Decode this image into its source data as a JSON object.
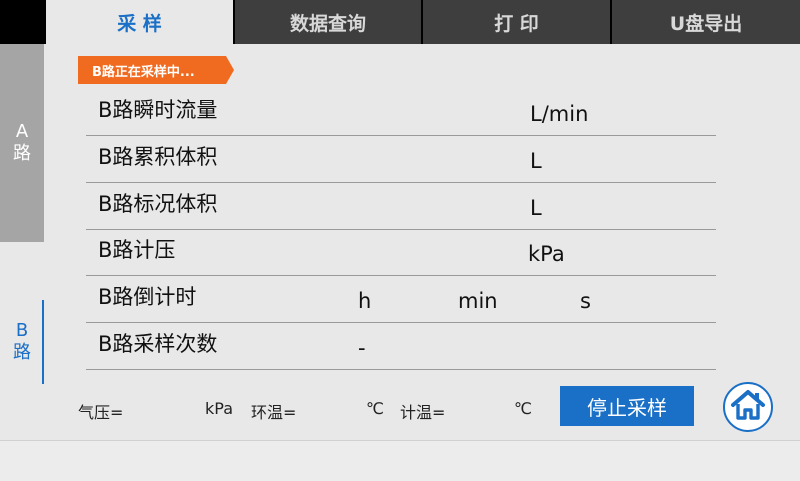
{
  "tabs": [
    {
      "label": "采 样"
    },
    {
      "label": "数据查询"
    },
    {
      "label": "打 印"
    },
    {
      "label": "U盘导出"
    }
  ],
  "side": {
    "a_letter": "A",
    "a_char": "路",
    "b_letter": "B",
    "b_char": "路"
  },
  "status": "B路正在采样中...",
  "rows": [
    {
      "label": "B路瞬时流量",
      "unit": "L/min"
    },
    {
      "label": "B路累积体积",
      "unit": "L"
    },
    {
      "label": "B路标况体积",
      "unit": "L"
    },
    {
      "label": "B路计压",
      "unit": "kPa"
    },
    {
      "label": "B路倒计时",
      "h": "h",
      "min": "min",
      "s": "s"
    },
    {
      "label": "B路采样次数",
      "value": "-"
    }
  ],
  "footer": {
    "pressure_label": "气压=",
    "pressure_unit": "kPa",
    "ambient_label": "环温=",
    "ambient_unit": "℃",
    "meter_label": "计温=",
    "meter_unit": "℃",
    "stop_button": "停止采样"
  },
  "colors": {
    "accent": "#1a6fc6",
    "status": "#f06a1f"
  },
  "icons": {
    "home": "home-icon"
  }
}
